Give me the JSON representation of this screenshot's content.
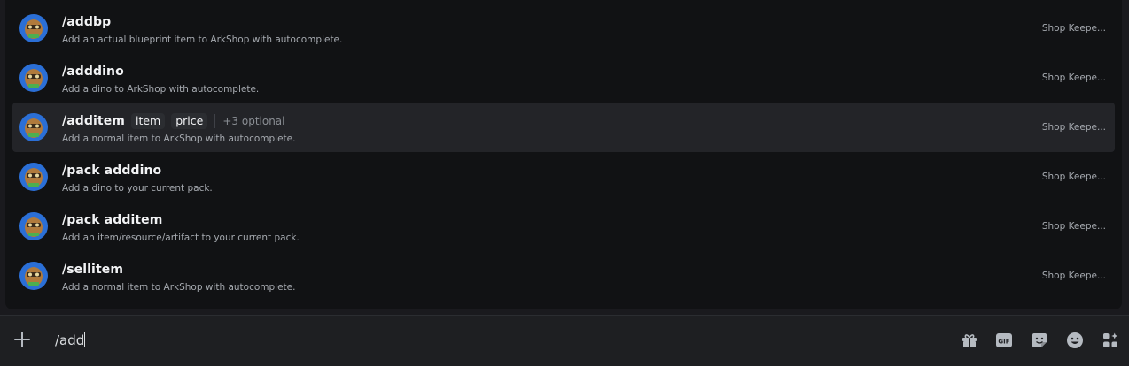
{
  "suggestions": [
    {
      "command": "/addbp",
      "description": "Add an actual blueprint item to ArkShop with autocomplete.",
      "source": "Shop Keepe..."
    },
    {
      "command": "/adddino",
      "description": "Add a dino to ArkShop with autocomplete.",
      "source": "Shop Keepe..."
    },
    {
      "command": "/additem",
      "options": [
        "item",
        "price"
      ],
      "more": "+3 optional",
      "description": "Add a normal item to ArkShop with autocomplete.",
      "source": "Shop Keepe...",
      "selected": true
    },
    {
      "command": "/pack adddino",
      "description": "Add a dino to your current pack.",
      "source": "Shop Keepe..."
    },
    {
      "command": "/pack additem",
      "description": "Add an item/resource/artifact to your current pack.",
      "source": "Shop Keepe..."
    },
    {
      "command": "/sellitem",
      "description": "Add a normal item to ArkShop with autocomplete.",
      "source": "Shop Keepe..."
    }
  ],
  "input": {
    "value": "/add"
  },
  "toolbar": {
    "icons": [
      "plus-icon",
      "gift-icon",
      "gif-icon",
      "sticker-icon",
      "emoji-icon",
      "apps-icon"
    ],
    "gif_label": "GIF"
  },
  "colors": {
    "background": "#1e1f22",
    "popup": "#111214",
    "selected_row": "#232428",
    "text": "#dbdee1"
  }
}
